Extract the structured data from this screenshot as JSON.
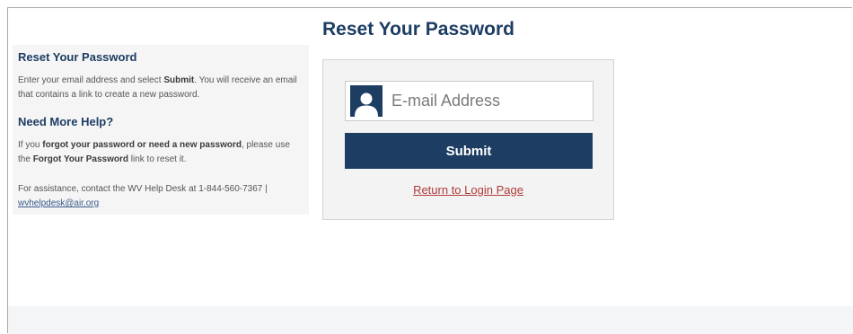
{
  "page_title": "Reset Your Password",
  "sidebar": {
    "heading1": "Reset Your Password",
    "p1_a": "Enter your email address and select ",
    "p1_b": "Submit",
    "p1_c": ". You will receive an email that contains a link to create a new password.",
    "heading2": "Need More Help?",
    "p2_a": "If you ",
    "p2_b": "forgot your password or need a new password",
    "p2_c": ", please use the ",
    "p2_d": "Forgot Your Password",
    "p2_e": " link to reset it.",
    "assist_text": "For assistance, contact the WV Help Desk at 1-844-560-7367 | ",
    "assist_email": "wvhelpdesk@air.org"
  },
  "form": {
    "email_placeholder": "E-mail Address",
    "email_value": "",
    "submit_label": "Submit",
    "return_link": "Return to Login Page",
    "icon": "user-icon"
  },
  "colors": {
    "brand": "#1d3d63",
    "link_red": "#b03a3a"
  }
}
